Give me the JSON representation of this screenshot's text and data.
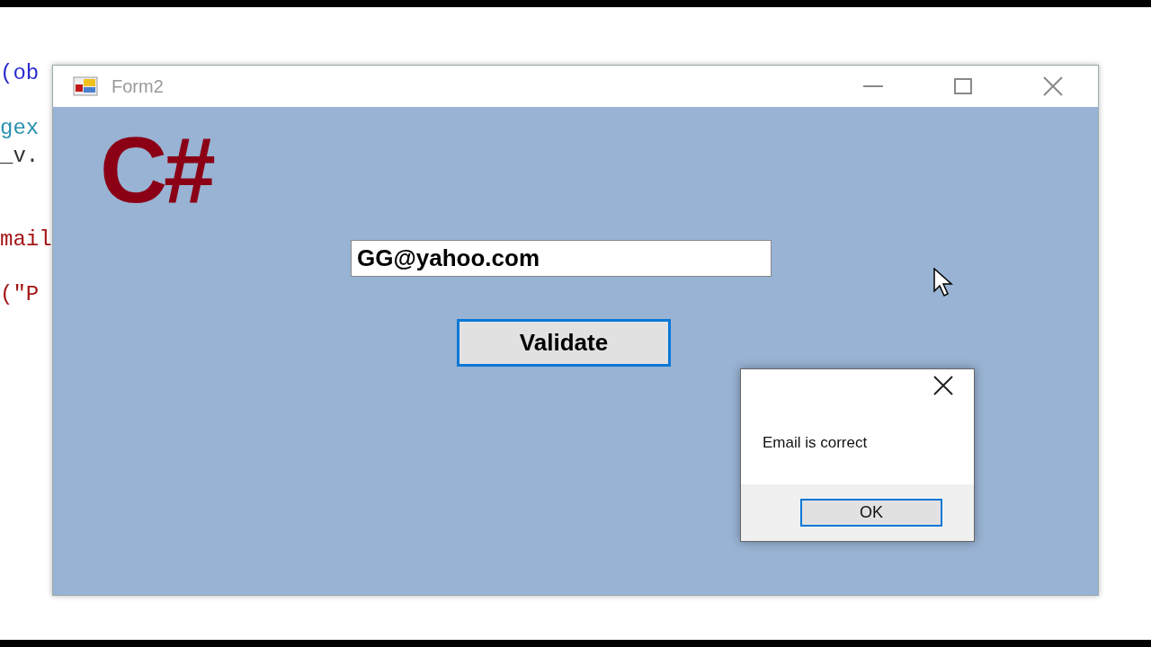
{
  "background_code": [
    {
      "text": "(ob",
      "color": "#2a2ad0"
    },
    {
      "text": "gex",
      "color": "#2b91af"
    },
    {
      "text": "_v.",
      "color": "#333333"
    },
    {
      "text": "mail",
      "color": "#a31515"
    },
    {
      "text": "(\"P",
      "color": "#a31515"
    }
  ],
  "window": {
    "title": "Form2",
    "logo_text": "C#",
    "email_field": {
      "value": "GG@yahoo.com"
    },
    "validate_button": "Validate"
  },
  "message_box": {
    "message": "Email is correct",
    "button": "OK"
  }
}
